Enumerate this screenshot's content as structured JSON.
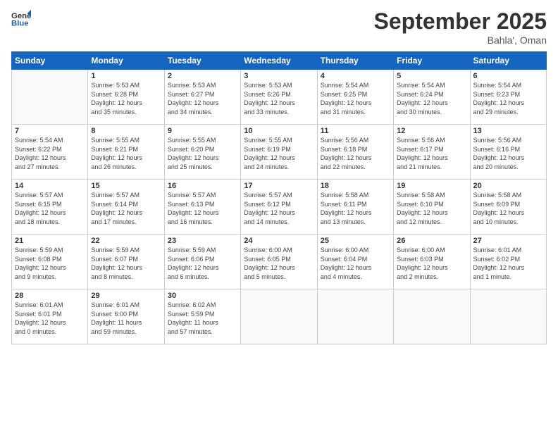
{
  "header": {
    "logo_line1": "General",
    "logo_line2": "Blue",
    "month_title": "September 2025",
    "location": "Bahla', Oman"
  },
  "days_of_week": [
    "Sunday",
    "Monday",
    "Tuesday",
    "Wednesday",
    "Thursday",
    "Friday",
    "Saturday"
  ],
  "weeks": [
    [
      {
        "day": "",
        "text": ""
      },
      {
        "day": "1",
        "text": "Sunrise: 5:53 AM\nSunset: 6:28 PM\nDaylight: 12 hours\nand 35 minutes."
      },
      {
        "day": "2",
        "text": "Sunrise: 5:53 AM\nSunset: 6:27 PM\nDaylight: 12 hours\nand 34 minutes."
      },
      {
        "day": "3",
        "text": "Sunrise: 5:53 AM\nSunset: 6:26 PM\nDaylight: 12 hours\nand 33 minutes."
      },
      {
        "day": "4",
        "text": "Sunrise: 5:54 AM\nSunset: 6:25 PM\nDaylight: 12 hours\nand 31 minutes."
      },
      {
        "day": "5",
        "text": "Sunrise: 5:54 AM\nSunset: 6:24 PM\nDaylight: 12 hours\nand 30 minutes."
      },
      {
        "day": "6",
        "text": "Sunrise: 5:54 AM\nSunset: 6:23 PM\nDaylight: 12 hours\nand 29 minutes."
      }
    ],
    [
      {
        "day": "7",
        "text": "Sunrise: 5:54 AM\nSunset: 6:22 PM\nDaylight: 12 hours\nand 27 minutes."
      },
      {
        "day": "8",
        "text": "Sunrise: 5:55 AM\nSunset: 6:21 PM\nDaylight: 12 hours\nand 26 minutes."
      },
      {
        "day": "9",
        "text": "Sunrise: 5:55 AM\nSunset: 6:20 PM\nDaylight: 12 hours\nand 25 minutes."
      },
      {
        "day": "10",
        "text": "Sunrise: 5:55 AM\nSunset: 6:19 PM\nDaylight: 12 hours\nand 24 minutes."
      },
      {
        "day": "11",
        "text": "Sunrise: 5:56 AM\nSunset: 6:18 PM\nDaylight: 12 hours\nand 22 minutes."
      },
      {
        "day": "12",
        "text": "Sunrise: 5:56 AM\nSunset: 6:17 PM\nDaylight: 12 hours\nand 21 minutes."
      },
      {
        "day": "13",
        "text": "Sunrise: 5:56 AM\nSunset: 6:16 PM\nDaylight: 12 hours\nand 20 minutes."
      }
    ],
    [
      {
        "day": "14",
        "text": "Sunrise: 5:57 AM\nSunset: 6:15 PM\nDaylight: 12 hours\nand 18 minutes."
      },
      {
        "day": "15",
        "text": "Sunrise: 5:57 AM\nSunset: 6:14 PM\nDaylight: 12 hours\nand 17 minutes."
      },
      {
        "day": "16",
        "text": "Sunrise: 5:57 AM\nSunset: 6:13 PM\nDaylight: 12 hours\nand 16 minutes."
      },
      {
        "day": "17",
        "text": "Sunrise: 5:57 AM\nSunset: 6:12 PM\nDaylight: 12 hours\nand 14 minutes."
      },
      {
        "day": "18",
        "text": "Sunrise: 5:58 AM\nSunset: 6:11 PM\nDaylight: 12 hours\nand 13 minutes."
      },
      {
        "day": "19",
        "text": "Sunrise: 5:58 AM\nSunset: 6:10 PM\nDaylight: 12 hours\nand 12 minutes."
      },
      {
        "day": "20",
        "text": "Sunrise: 5:58 AM\nSunset: 6:09 PM\nDaylight: 12 hours\nand 10 minutes."
      }
    ],
    [
      {
        "day": "21",
        "text": "Sunrise: 5:59 AM\nSunset: 6:08 PM\nDaylight: 12 hours\nand 9 minutes."
      },
      {
        "day": "22",
        "text": "Sunrise: 5:59 AM\nSunset: 6:07 PM\nDaylight: 12 hours\nand 8 minutes."
      },
      {
        "day": "23",
        "text": "Sunrise: 5:59 AM\nSunset: 6:06 PM\nDaylight: 12 hours\nand 6 minutes."
      },
      {
        "day": "24",
        "text": "Sunrise: 6:00 AM\nSunset: 6:05 PM\nDaylight: 12 hours\nand 5 minutes."
      },
      {
        "day": "25",
        "text": "Sunrise: 6:00 AM\nSunset: 6:04 PM\nDaylight: 12 hours\nand 4 minutes."
      },
      {
        "day": "26",
        "text": "Sunrise: 6:00 AM\nSunset: 6:03 PM\nDaylight: 12 hours\nand 2 minutes."
      },
      {
        "day": "27",
        "text": "Sunrise: 6:01 AM\nSunset: 6:02 PM\nDaylight: 12 hours\nand 1 minute."
      }
    ],
    [
      {
        "day": "28",
        "text": "Sunrise: 6:01 AM\nSunset: 6:01 PM\nDaylight: 12 hours\nand 0 minutes."
      },
      {
        "day": "29",
        "text": "Sunrise: 6:01 AM\nSunset: 6:00 PM\nDaylight: 11 hours\nand 59 minutes."
      },
      {
        "day": "30",
        "text": "Sunrise: 6:02 AM\nSunset: 5:59 PM\nDaylight: 11 hours\nand 57 minutes."
      },
      {
        "day": "",
        "text": ""
      },
      {
        "day": "",
        "text": ""
      },
      {
        "day": "",
        "text": ""
      },
      {
        "day": "",
        "text": ""
      }
    ]
  ]
}
